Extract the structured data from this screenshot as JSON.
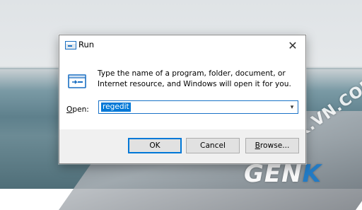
{
  "dialog": {
    "title": "Run",
    "close_glyph": "✕",
    "description": "Type the name of a program, folder, document, or Internet resource, and Windows will open it for you.",
    "open_label_prefix": "O",
    "open_label_rest": "pen:",
    "open_value": "regedit",
    "dropdown_glyph": "▾",
    "buttons": {
      "ok": "OK",
      "cancel": "Cancel",
      "browse_underlined": "B",
      "browse_rest": "rowse..."
    }
  },
  "watermarks": {
    "diagonal": "GENK.VN.COM",
    "bottom_prefix": "GEN",
    "bottom_accent": "K"
  },
  "icons": {
    "title": "run-icon",
    "content": "run-icon",
    "close": "close-icon",
    "dropdown": "chevron-down-icon"
  },
  "colors": {
    "accent": "#0078d7",
    "dialog_bg": "#f0f0f0"
  }
}
